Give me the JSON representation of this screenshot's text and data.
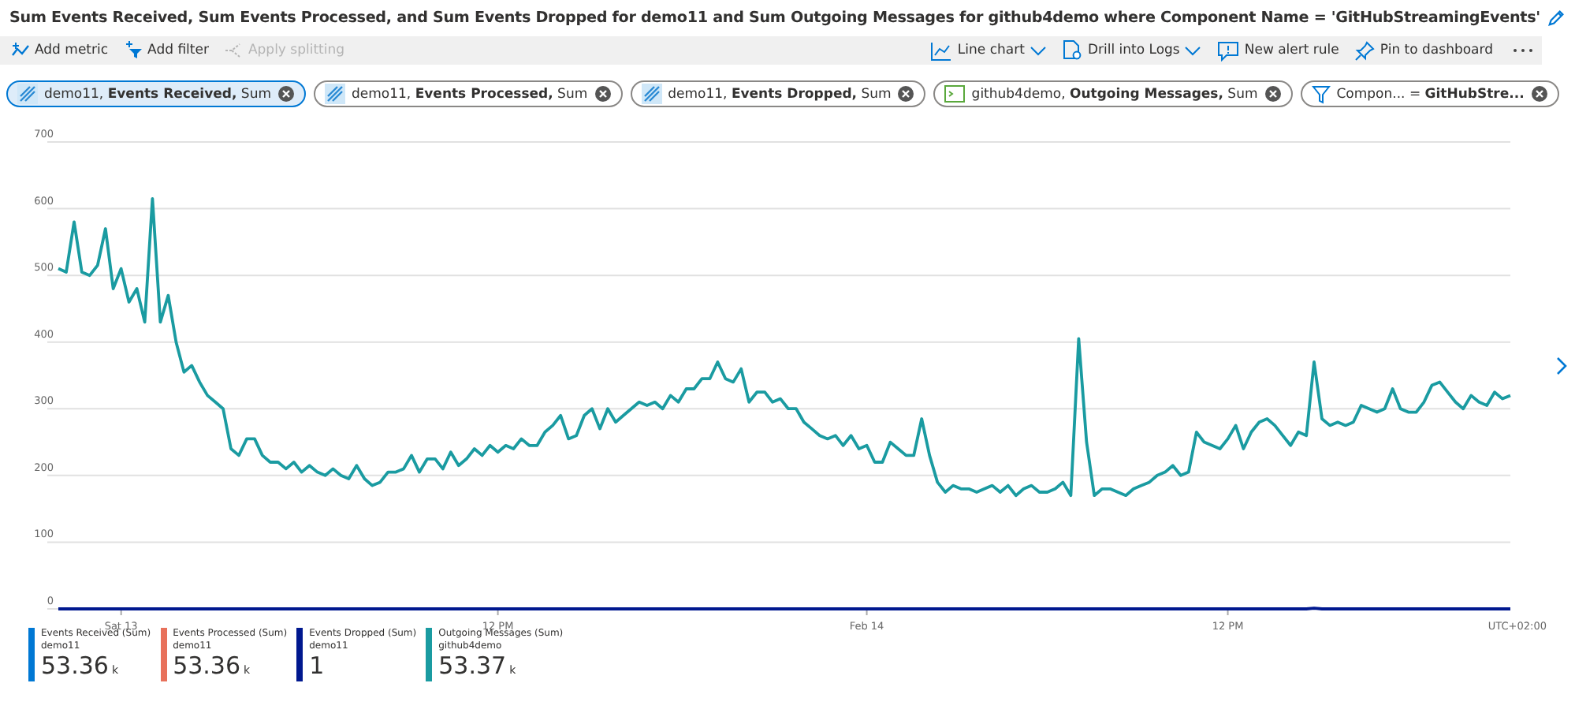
{
  "title": "Sum Events Received, Sum Events Processed, and Sum Events Dropped for demo11 and Sum Outgoing Messages for github4demo where Component Name = 'GitHubStreamingEvents'",
  "toolbar_left": [
    {
      "kind": "metric",
      "label": "Add metric",
      "disabled": false
    },
    {
      "kind": "filter",
      "label": "Add filter",
      "disabled": false
    },
    {
      "kind": "split",
      "label": "Apply splitting",
      "disabled": true
    }
  ],
  "toolbar_right": [
    {
      "kind": "chart",
      "label": "Line chart",
      "dropdown": true
    },
    {
      "kind": "logs",
      "label": "Drill into Logs",
      "dropdown": true
    },
    {
      "kind": "alert",
      "label": "New alert rule",
      "dropdown": false
    },
    {
      "kind": "pin",
      "label": "Pin to dashboard",
      "dropdown": false
    }
  ],
  "pills": [
    {
      "kind": "metric",
      "label": "demo11, **Events Received,** Sum",
      "selected": true
    },
    {
      "kind": "metric",
      "label": "demo11, **Events Processed,** Sum",
      "selected": false
    },
    {
      "kind": "metric",
      "label": "demo11, **Events Dropped,** Sum",
      "selected": false
    },
    {
      "kind": "app",
      "label": "github4demo, **Outgoing Messages,** Sum",
      "selected": false
    },
    {
      "kind": "filter",
      "label": "Compon... = **GitHubStre...**",
      "selected": false
    }
  ],
  "chart": {
    "timezone_label": "UTC+02:00",
    "chart_data": {
      "type": "line",
      "grid": true,
      "categories": [
        null,
        null,
        null,
        null,
        null,
        null,
        null,
        null,
        "Sat 13",
        null,
        null,
        null,
        null,
        null,
        null,
        null,
        null,
        null,
        null,
        null,
        null,
        null,
        null,
        null,
        null,
        null,
        null,
        null,
        null,
        null,
        null,
        null,
        null,
        null,
        null,
        null,
        null,
        null,
        null,
        null,
        null,
        null,
        null,
        null,
        null,
        null,
        null,
        null,
        null,
        null,
        null,
        null,
        null,
        null,
        null,
        null,
        "12 PM",
        null,
        null,
        null,
        null,
        null,
        null,
        null,
        null,
        null,
        null,
        null,
        null,
        null,
        null,
        null,
        null,
        null,
        null,
        null,
        null,
        null,
        null,
        null,
        null,
        null,
        null,
        null,
        null,
        null,
        null,
        null,
        null,
        null,
        null,
        null,
        null,
        null,
        null,
        null,
        null,
        null,
        null,
        null,
        null,
        null,
        null,
        "Feb 14",
        null,
        null,
        null,
        null,
        null,
        null,
        null,
        null,
        null,
        null,
        null,
        null,
        null,
        null,
        null,
        null,
        null,
        null,
        null,
        null,
        null,
        null,
        null,
        null,
        null,
        null,
        null,
        null,
        null,
        null,
        null,
        null,
        null,
        null,
        null,
        null,
        null,
        null,
        null,
        null,
        null,
        null,
        null,
        null,
        null,
        "12 PM",
        null,
        null,
        null,
        null,
        null,
        null,
        null,
        null,
        null,
        null,
        null,
        null,
        null,
        null,
        null,
        null,
        null,
        null,
        null,
        null,
        null,
        null,
        null,
        null,
        null,
        null,
        null,
        null,
        null,
        null,
        null,
        null,
        null,
        null,
        null,
        null
      ],
      "ylim": [
        0,
        700
      ],
      "yticks": [
        0,
        100,
        200,
        300,
        400,
        500,
        600,
        700
      ],
      "series": [
        {
          "color": "#00188f",
          "values": [
            0,
            0,
            0,
            0,
            0,
            0,
            0,
            0,
            0,
            0,
            0,
            0,
            0,
            0,
            0,
            0,
            0,
            0,
            0,
            0,
            0,
            0,
            0,
            0,
            0,
            0,
            0,
            0,
            0,
            0,
            0,
            0,
            0,
            0,
            0,
            0,
            0,
            0,
            0,
            0,
            0,
            0,
            0,
            0,
            0,
            0,
            0,
            0,
            0,
            0,
            0,
            0,
            0,
            0,
            0,
            0,
            0,
            0,
            0,
            0,
            0,
            0,
            0,
            0,
            0,
            0,
            0,
            0,
            0,
            0,
            0,
            0,
            0,
            0,
            0,
            0,
            0,
            0,
            0,
            0,
            0,
            0,
            0,
            0,
            0,
            0,
            0,
            0,
            0,
            0,
            0,
            0,
            0,
            0,
            0,
            0,
            0,
            0,
            0,
            0,
            0,
            0,
            0,
            0,
            0,
            0,
            0,
            0,
            0,
            0,
            0,
            0,
            0,
            0,
            0,
            0,
            0,
            0,
            0,
            0,
            0,
            0,
            0,
            0,
            0,
            0,
            0,
            0,
            0,
            0,
            0,
            0,
            0,
            0,
            0,
            0,
            0,
            0,
            0,
            0,
            0,
            0,
            0,
            0,
            0,
            0,
            0,
            0,
            0,
            0,
            0,
            0,
            0,
            0,
            0,
            0,
            0,
            0,
            0,
            0,
            1,
            0,
            0,
            0,
            0,
            0,
            0,
            0,
            0,
            0,
            0,
            0,
            0,
            0,
            0,
            0,
            0,
            0,
            0,
            0,
            0,
            0,
            0,
            0,
            0,
            0
          ]
        },
        {
          "color": "#1a9ba1",
          "values": [
            510,
            505,
            580,
            505,
            500,
            515,
            570,
            480,
            510,
            460,
            480,
            430,
            615,
            430,
            470,
            400,
            355,
            365,
            340,
            320,
            310,
            300,
            240,
            230,
            255,
            255,
            230,
            220,
            220,
            210,
            220,
            205,
            215,
            205,
            200,
            210,
            200,
            195,
            215,
            195,
            185,
            190,
            205,
            205,
            210,
            230,
            205,
            225,
            225,
            210,
            235,
            215,
            225,
            240,
            230,
            245,
            235,
            245,
            240,
            255,
            245,
            245,
            265,
            275,
            290,
            255,
            260,
            290,
            300,
            270,
            300,
            280,
            290,
            300,
            310,
            305,
            310,
            300,
            320,
            310,
            330,
            330,
            345,
            345,
            370,
            345,
            340,
            360,
            310,
            325,
            325,
            310,
            315,
            300,
            300,
            280,
            270,
            260,
            255,
            260,
            245,
            260,
            240,
            245,
            220,
            220,
            250,
            240,
            230,
            230,
            285,
            230,
            190,
            175,
            185,
            180,
            180,
            175,
            180,
            185,
            175,
            185,
            170,
            180,
            185,
            175,
            175,
            180,
            190,
            170,
            405,
            250,
            170,
            180,
            180,
            175,
            170,
            180,
            185,
            190,
            200,
            205,
            215,
            200,
            205,
            265,
            250,
            245,
            240,
            255,
            275,
            240,
            265,
            280,
            285,
            275,
            260,
            245,
            265,
            260,
            370,
            285,
            275,
            280,
            275,
            280,
            305,
            300,
            295,
            300,
            330,
            300,
            295,
            295,
            310,
            335,
            340,
            325,
            310,
            300,
            320,
            310,
            305,
            325,
            315,
            320
          ]
        }
      ]
    }
  },
  "legend": [
    {
      "label": "Events Received (Sum)",
      "resource": "demo11",
      "value": "53.36",
      "unit": "k",
      "color": "#0078d4"
    },
    {
      "label": "Events Processed (Sum)",
      "resource": "demo11",
      "value": "53.36",
      "unit": "k",
      "color": "#e8715b"
    },
    {
      "label": "Events Dropped (Sum)",
      "resource": "demo11",
      "value": "1",
      "color": "#00188f"
    },
    {
      "label": "Outgoing Messages (Sum)",
      "resource": "github4demo",
      "value": "53.37",
      "unit": "k",
      "color": "#1a9ba1"
    }
  ]
}
